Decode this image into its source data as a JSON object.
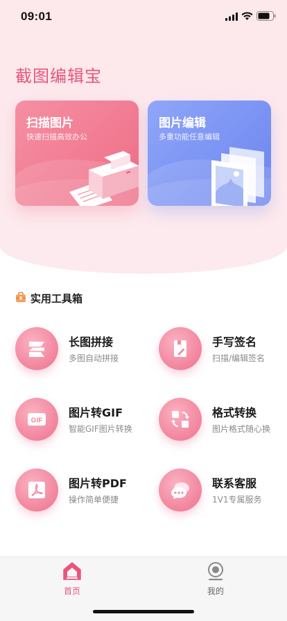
{
  "status_bar": {
    "time": "09:01"
  },
  "app": {
    "title": "截图编辑宝"
  },
  "cards": [
    {
      "title": "扫描图片",
      "subtitle": "快速扫描高效办公",
      "icon": "printer-illustration"
    },
    {
      "title": "图片编辑",
      "subtitle": "多重功能任意编辑",
      "icon": "image-stack-illustration"
    }
  ],
  "toolbox": {
    "title": "实用工具箱",
    "icon": "toolbox-icon",
    "tools": [
      {
        "title": "长图拼接",
        "subtitle": "多图自动拼接",
        "icon": "stitch-icon"
      },
      {
        "title": "手写签名",
        "subtitle": "扫描/编辑签名",
        "icon": "signature-icon"
      },
      {
        "title": "图片转GIF",
        "subtitle": "智能GIF图片转换",
        "icon": "gif-icon",
        "icon_text": "GIF"
      },
      {
        "title": "格式转换",
        "subtitle": "图片格式随心换",
        "icon": "format-convert-icon"
      },
      {
        "title": "图片转PDF",
        "subtitle": "操作简单便捷",
        "icon": "pdf-icon"
      },
      {
        "title": "联系客服",
        "subtitle": "1V1专属服务",
        "icon": "chat-icon"
      }
    ]
  },
  "tabbar": {
    "items": [
      {
        "label": "首页",
        "icon": "home-icon",
        "active": true
      },
      {
        "label": "我的",
        "icon": "profile-icon",
        "active": false
      }
    ]
  },
  "colors": {
    "accent": "#e8557d",
    "scan_card": "#ee6d86",
    "edit_card": "#6b84ef",
    "tool_circle": "#f38aa2"
  }
}
